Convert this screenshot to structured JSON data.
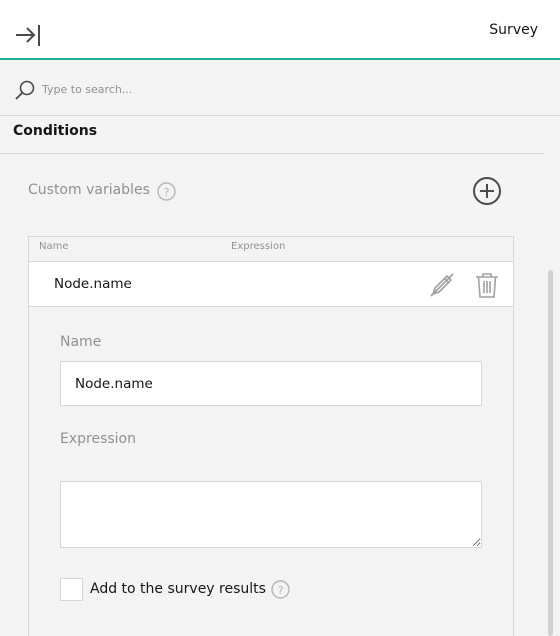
{
  "header": {
    "title": "Survey",
    "collapse_icon": "collapse-panel-icon"
  },
  "search": {
    "placeholder": "Type to search...",
    "value": "",
    "icon": "search-icon"
  },
  "section": {
    "title": "Conditions"
  },
  "custom_variables": {
    "label": "Custom variables",
    "help_icon": "help-icon",
    "add_icon": "add-circle-icon",
    "columns": [
      "Name",
      "Expression"
    ],
    "rows": [
      {
        "name": "Node.name",
        "edit_icon": "edit-disabled-icon",
        "delete_icon": "trash-icon"
      }
    ]
  },
  "editor": {
    "name_label": "Name",
    "name_value": "Node.name",
    "expression_label": "Expression",
    "expression_value": "",
    "checkbox_label": "Add to the survey results",
    "checkbox_checked": false,
    "help_icon": "help-icon"
  },
  "colors": {
    "accent": "#19b394",
    "background": "#f3f3f3",
    "text": "#161616",
    "muted": "#909090",
    "border": "#d6d6d6"
  }
}
